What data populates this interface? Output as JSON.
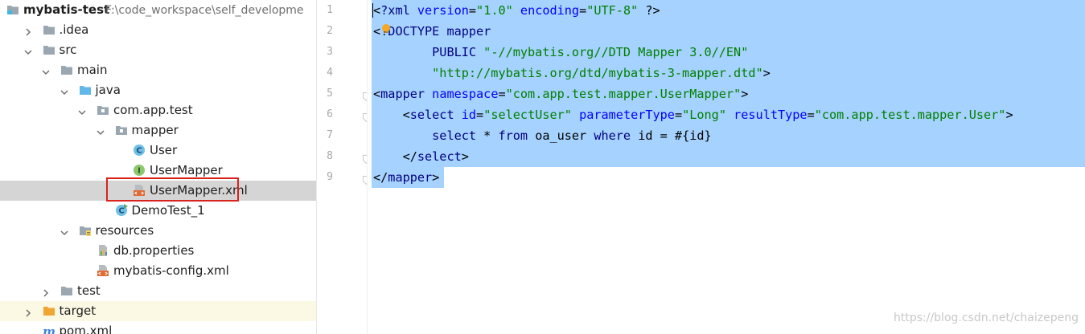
{
  "project": {
    "name": "mybatis-test",
    "path": "F:\\code_workspace\\self_developme"
  },
  "tree": [
    {
      "label": "mybatis-test",
      "depth": 0,
      "icon": "module-folder-icon",
      "arrow": "none",
      "name": "project-root",
      "bold": true
    },
    {
      "label": ".idea",
      "depth": 1,
      "icon": "folder-icon",
      "arrow": "right",
      "name": "tree-item-idea"
    },
    {
      "label": "src",
      "depth": 1,
      "icon": "folder-icon",
      "arrow": "down",
      "name": "tree-item-src"
    },
    {
      "label": "main",
      "depth": 2,
      "icon": "folder-icon",
      "arrow": "down",
      "name": "tree-item-main"
    },
    {
      "label": "java",
      "depth": 3,
      "icon": "source-folder-icon",
      "arrow": "down",
      "name": "tree-item-java"
    },
    {
      "label": "com.app.test",
      "depth": 4,
      "icon": "package-icon",
      "arrow": "down",
      "name": "tree-item-com-app-test"
    },
    {
      "label": "mapper",
      "depth": 5,
      "icon": "package-icon",
      "arrow": "down",
      "name": "tree-item-mapper"
    },
    {
      "label": "User",
      "depth": 6,
      "icon": "class-icon",
      "arrow": "none",
      "name": "tree-item-user"
    },
    {
      "label": "UserMapper",
      "depth": 6,
      "icon": "interface-icon",
      "arrow": "none",
      "name": "tree-item-usermapper"
    },
    {
      "label": "UserMapper.xml",
      "depth": 6,
      "icon": "xml-file-icon",
      "arrow": "none",
      "name": "tree-item-usermapper-xml",
      "selected": true
    },
    {
      "label": "DemoTest_1",
      "depth": 5,
      "icon": "runnable-class-icon",
      "arrow": "none",
      "name": "tree-item-demotest"
    },
    {
      "label": "resources",
      "depth": 3,
      "icon": "resources-folder-icon",
      "arrow": "down",
      "name": "tree-item-resources"
    },
    {
      "label": "db.properties",
      "depth": 4,
      "icon": "properties-file-icon",
      "arrow": "none",
      "name": "tree-item-db-properties"
    },
    {
      "label": "mybatis-config.xml",
      "depth": 4,
      "icon": "xml-file-icon",
      "arrow": "none",
      "name": "tree-item-mybatis-config"
    },
    {
      "label": "test",
      "depth": 2,
      "icon": "folder-icon",
      "arrow": "right",
      "name": "tree-item-test"
    },
    {
      "label": "target",
      "depth": 1,
      "icon": "excluded-folder-icon",
      "arrow": "right",
      "name": "tree-item-target",
      "excluded": true
    },
    {
      "label": "pom.xml",
      "depth": 1,
      "icon": "maven-file-icon",
      "arrow": "none",
      "name": "tree-item-pom"
    }
  ],
  "icon_badges": {
    "class": "C",
    "interface": "I"
  },
  "editor": {
    "line_numbers": [
      "1",
      "2",
      "3",
      "4",
      "5",
      "6",
      "7",
      "8",
      "9"
    ],
    "lines": [
      [
        [
          "t-punc",
          "<"
        ],
        [
          "t-tag",
          "?xml "
        ],
        [
          "t-attr",
          "version"
        ],
        [
          "t-punc",
          "="
        ],
        [
          "t-str",
          "\"1.0\" "
        ],
        [
          "t-attr",
          "encoding"
        ],
        [
          "t-punc",
          "="
        ],
        [
          "t-str",
          "\"UTF-8\" "
        ],
        [
          "t-punc",
          "?>"
        ]
      ],
      [
        [
          "t-punc",
          "<!"
        ],
        [
          "t-doc",
          "DOCTYPE mapper"
        ]
      ],
      [
        [
          "t-plain",
          "        "
        ],
        [
          "t-doc",
          "PUBLIC "
        ],
        [
          "t-str",
          "\"-//mybatis.org//DTD Mapper 3.0//EN\""
        ]
      ],
      [
        [
          "t-plain",
          "        "
        ],
        [
          "t-str",
          "\"http://mybatis.org/dtd/mybatis-3-mapper.dtd\""
        ],
        [
          "t-punc",
          ">"
        ]
      ],
      [
        [
          "t-punc",
          "<"
        ],
        [
          "t-tag",
          "mapper "
        ],
        [
          "t-attr",
          "namespace"
        ],
        [
          "t-punc",
          "="
        ],
        [
          "t-str",
          "\"com.app.test.mapper.UserMapper\""
        ],
        [
          "t-punc",
          ">"
        ]
      ],
      [
        [
          "t-plain",
          "    "
        ],
        [
          "t-punc",
          "<"
        ],
        [
          "t-tag",
          "select "
        ],
        [
          "t-attr",
          "id"
        ],
        [
          "t-punc",
          "="
        ],
        [
          "t-str",
          "\"selectUser\" "
        ],
        [
          "t-attr",
          "parameterType"
        ],
        [
          "t-punc",
          "="
        ],
        [
          "t-str",
          "\"Long\" "
        ],
        [
          "t-attr",
          "resultType"
        ],
        [
          "t-punc",
          "="
        ],
        [
          "t-str",
          "\"com.app.test.mapper.User\""
        ],
        [
          "t-punc",
          ">"
        ]
      ],
      [
        [
          "t-plain",
          "        "
        ],
        [
          "t-key",
          "select "
        ],
        [
          "t-plain",
          "* "
        ],
        [
          "t-key",
          "from "
        ],
        [
          "t-plain",
          "oa_user "
        ],
        [
          "t-key",
          "where "
        ],
        [
          "t-plain",
          "id = #{id}"
        ]
      ],
      [
        [
          "t-plain",
          "    "
        ],
        [
          "t-punc",
          "</"
        ],
        [
          "t-tag",
          "select"
        ],
        [
          "t-punc",
          ">"
        ]
      ],
      [
        [
          "t-punc",
          "</"
        ],
        [
          "t-tag",
          "mapper"
        ],
        [
          "t-punc",
          ">"
        ]
      ]
    ]
  },
  "watermark": "https://blog.csdn.net/chaizepeng",
  "colors": {
    "selection": "#a6d2ff",
    "tree_selected_row": "#d5d5d5",
    "highlight_box": "#d9231c",
    "folder": "#9aa7b0",
    "source_folder": "#62b8e8",
    "class_icon": "#6ebfe9",
    "interface_icon": "#8cc86d",
    "xml_icon": "#e06b35"
  }
}
